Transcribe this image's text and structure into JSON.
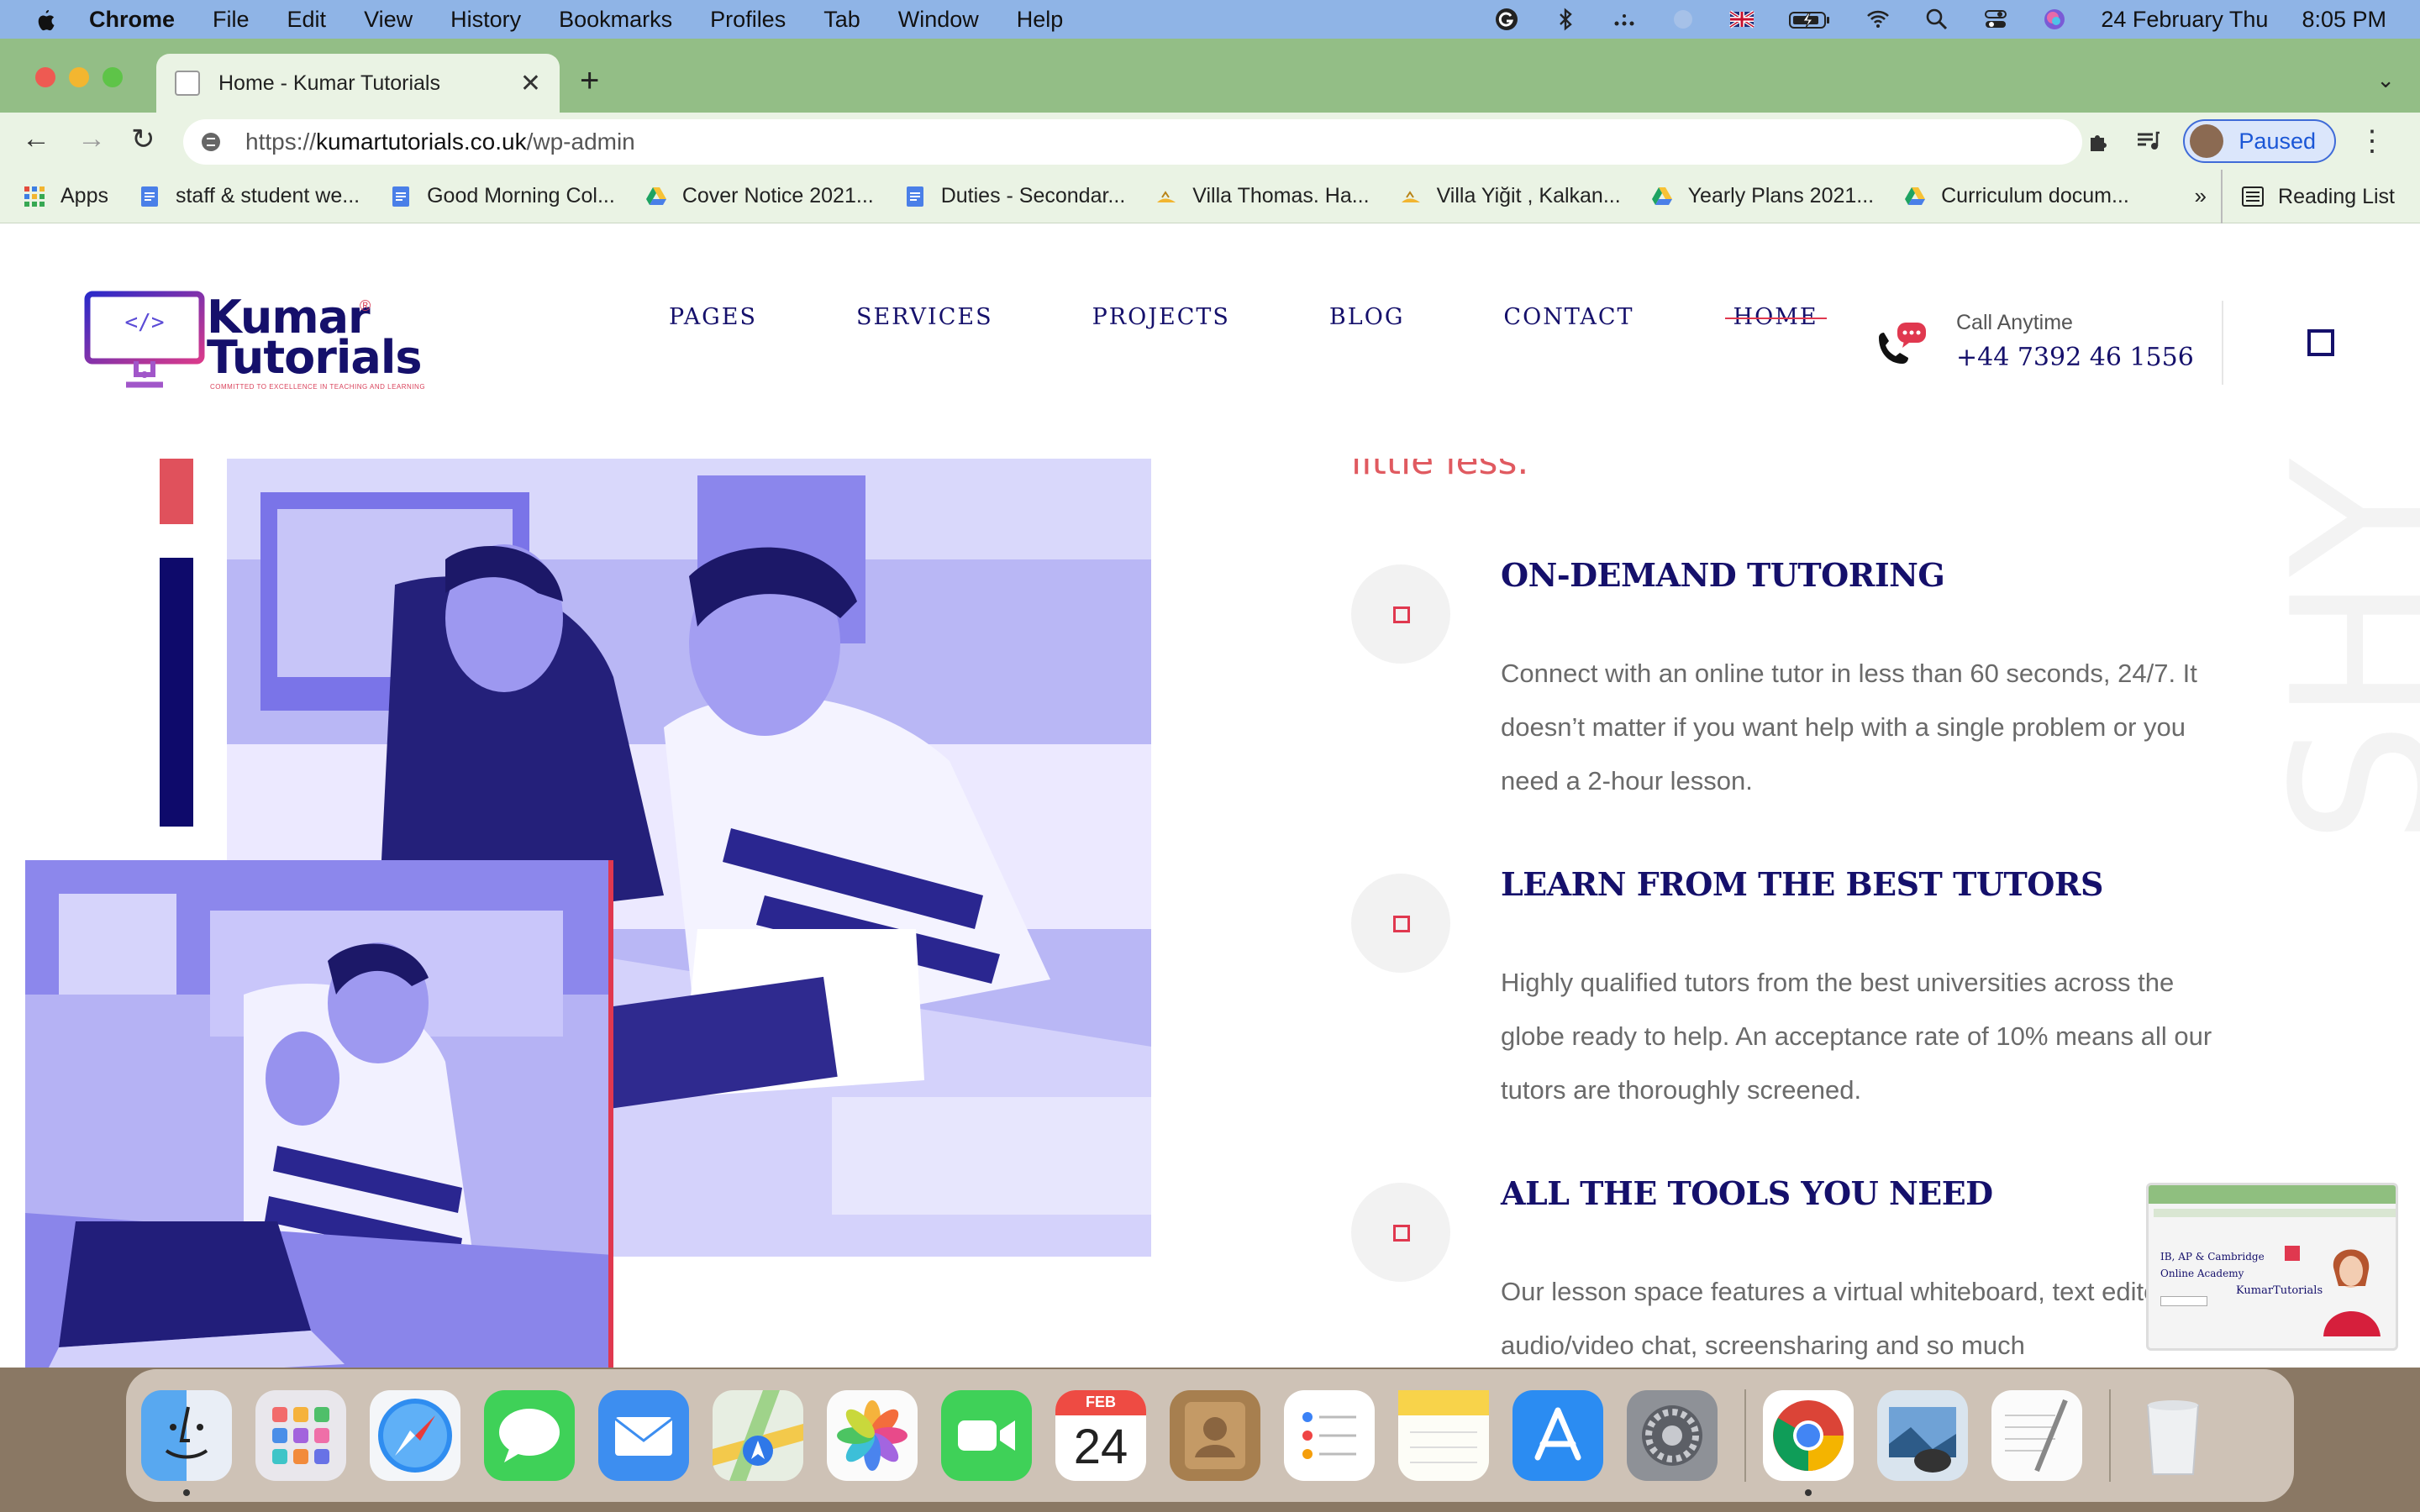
{
  "menubar": {
    "app_name": "Chrome",
    "items": [
      "File",
      "Edit",
      "View",
      "History",
      "Bookmarks",
      "Profiles",
      "Tab",
      "Window",
      "Help"
    ],
    "date": "24 February Thu",
    "time": "8:05 PM",
    "status_icons": [
      "grammarly-icon",
      "bluetooth-icon",
      "dots-icon",
      "blank-icon",
      "uk-flag-icon",
      "battery-icon",
      "wifi-icon",
      "search-icon",
      "control-center-icon",
      "siri-icon"
    ]
  },
  "browser": {
    "tab_title": "Home - Kumar Tutorials",
    "url_prefix": "https://",
    "url_host": "kumartutorials.co.uk",
    "url_path": "/wp-admin",
    "profile_label": "Paused",
    "bookmarks": [
      {
        "label": "Apps",
        "icon": "apps-grid-icon"
      },
      {
        "label": "staff & student we...",
        "icon": "docs-icon"
      },
      {
        "label": "Good Morning Col...",
        "icon": "docs-icon"
      },
      {
        "label": "Cover Notice 2021...",
        "icon": "drive-icon"
      },
      {
        "label": "Duties - Secondar...",
        "icon": "docs-icon"
      },
      {
        "label": "Villa Thomas. Ha...",
        "icon": "villa-icon"
      },
      {
        "label": "Villa Yiğit , Kalkan...",
        "icon": "villa-icon"
      },
      {
        "label": "Yearly Plans 2021...",
        "icon": "drive-icon"
      },
      {
        "label": "Curriculum docum...",
        "icon": "drive-icon"
      }
    ],
    "bookmarks_more": "»",
    "reading_list": "Reading List"
  },
  "site": {
    "logo": {
      "line1": "Kumar",
      "line2": "Tutorials",
      "reg": "®",
      "tagline": "COMMITTED TO EXCELLENCE IN TEACHING AND LEARNING"
    },
    "nav": [
      "PAGES",
      "SERVICES",
      "PROJECTS",
      "BLOG",
      "CONTACT",
      "HOME"
    ],
    "call_label": "Call Anytime",
    "call_number": "+44 7392 46 1556",
    "intro_tail": "little less.",
    "features": [
      {
        "title": "ON-DEMAND TUTORING",
        "description": "Connect with an online tutor in less than 60 seconds, 24/7. It doesn’t matter if you want help with a single problem or you need a 2-hour lesson."
      },
      {
        "title": "LEARN FROM THE BEST TUTORS",
        "description": "Highly qualified tutors from the best universities across the globe ready to help. An acceptance rate of 10% means all our tutors are thoroughly screened."
      },
      {
        "title": "ALL THE TOOLS YOU NEED",
        "description": "Our lesson space features a virtual whiteboard, text editor, audio/video chat, screensharing and so much"
      }
    ],
    "bg_letters": "SHY"
  },
  "pip": {
    "line1": "IB, AP & Cambridge",
    "line2": "Online Academy",
    "brand": "KumarTutorials"
  },
  "dock": {
    "calendar_month": "FEB",
    "calendar_day": "24",
    "apps": [
      "finder",
      "launchpad",
      "safari",
      "messages",
      "mail",
      "maps",
      "photos",
      "facetime",
      "calendar",
      "contacts",
      "reminders",
      "notes",
      "app-store",
      "system-preferences",
      "chrome",
      "preview",
      "textedit",
      "trash"
    ]
  },
  "colors": {
    "navy": "#15106b",
    "accent_red": "#e0384f",
    "photo_tint": "#5a55e6"
  }
}
